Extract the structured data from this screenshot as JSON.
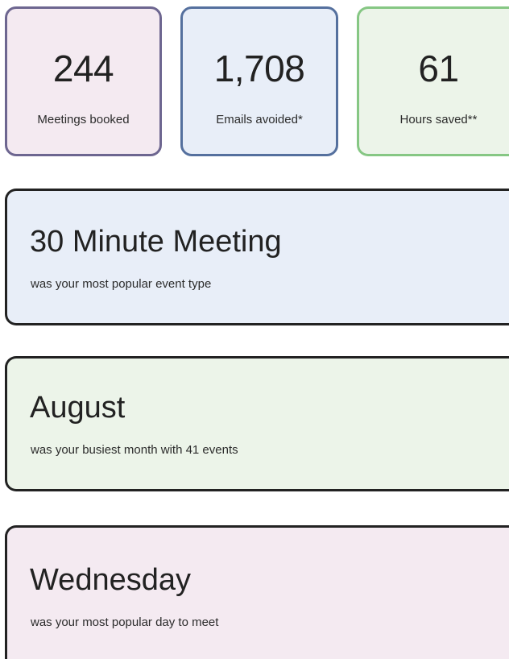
{
  "stats": [
    {
      "value": "244",
      "label": "Meetings booked"
    },
    {
      "value": "1,708",
      "label": "Emails avoided*"
    },
    {
      "value": "61",
      "label": "Hours saved**"
    }
  ],
  "highlights": {
    "event_type": {
      "title": "30 Minute Meeting",
      "subtitle": "was your most popular event type"
    },
    "month": {
      "title": "August",
      "subtitle": "was your busiest month with 41 events"
    },
    "day": {
      "title": "Wednesday",
      "subtitle": "was your most popular day to meet"
    }
  },
  "colors": {
    "pink_bg": "#f4eaf1",
    "pink_border": "#6d6690",
    "blue_bg": "#e8eef8",
    "blue_border": "#55709e",
    "green_bg": "#ecf4e9",
    "green_border": "#86c784"
  }
}
